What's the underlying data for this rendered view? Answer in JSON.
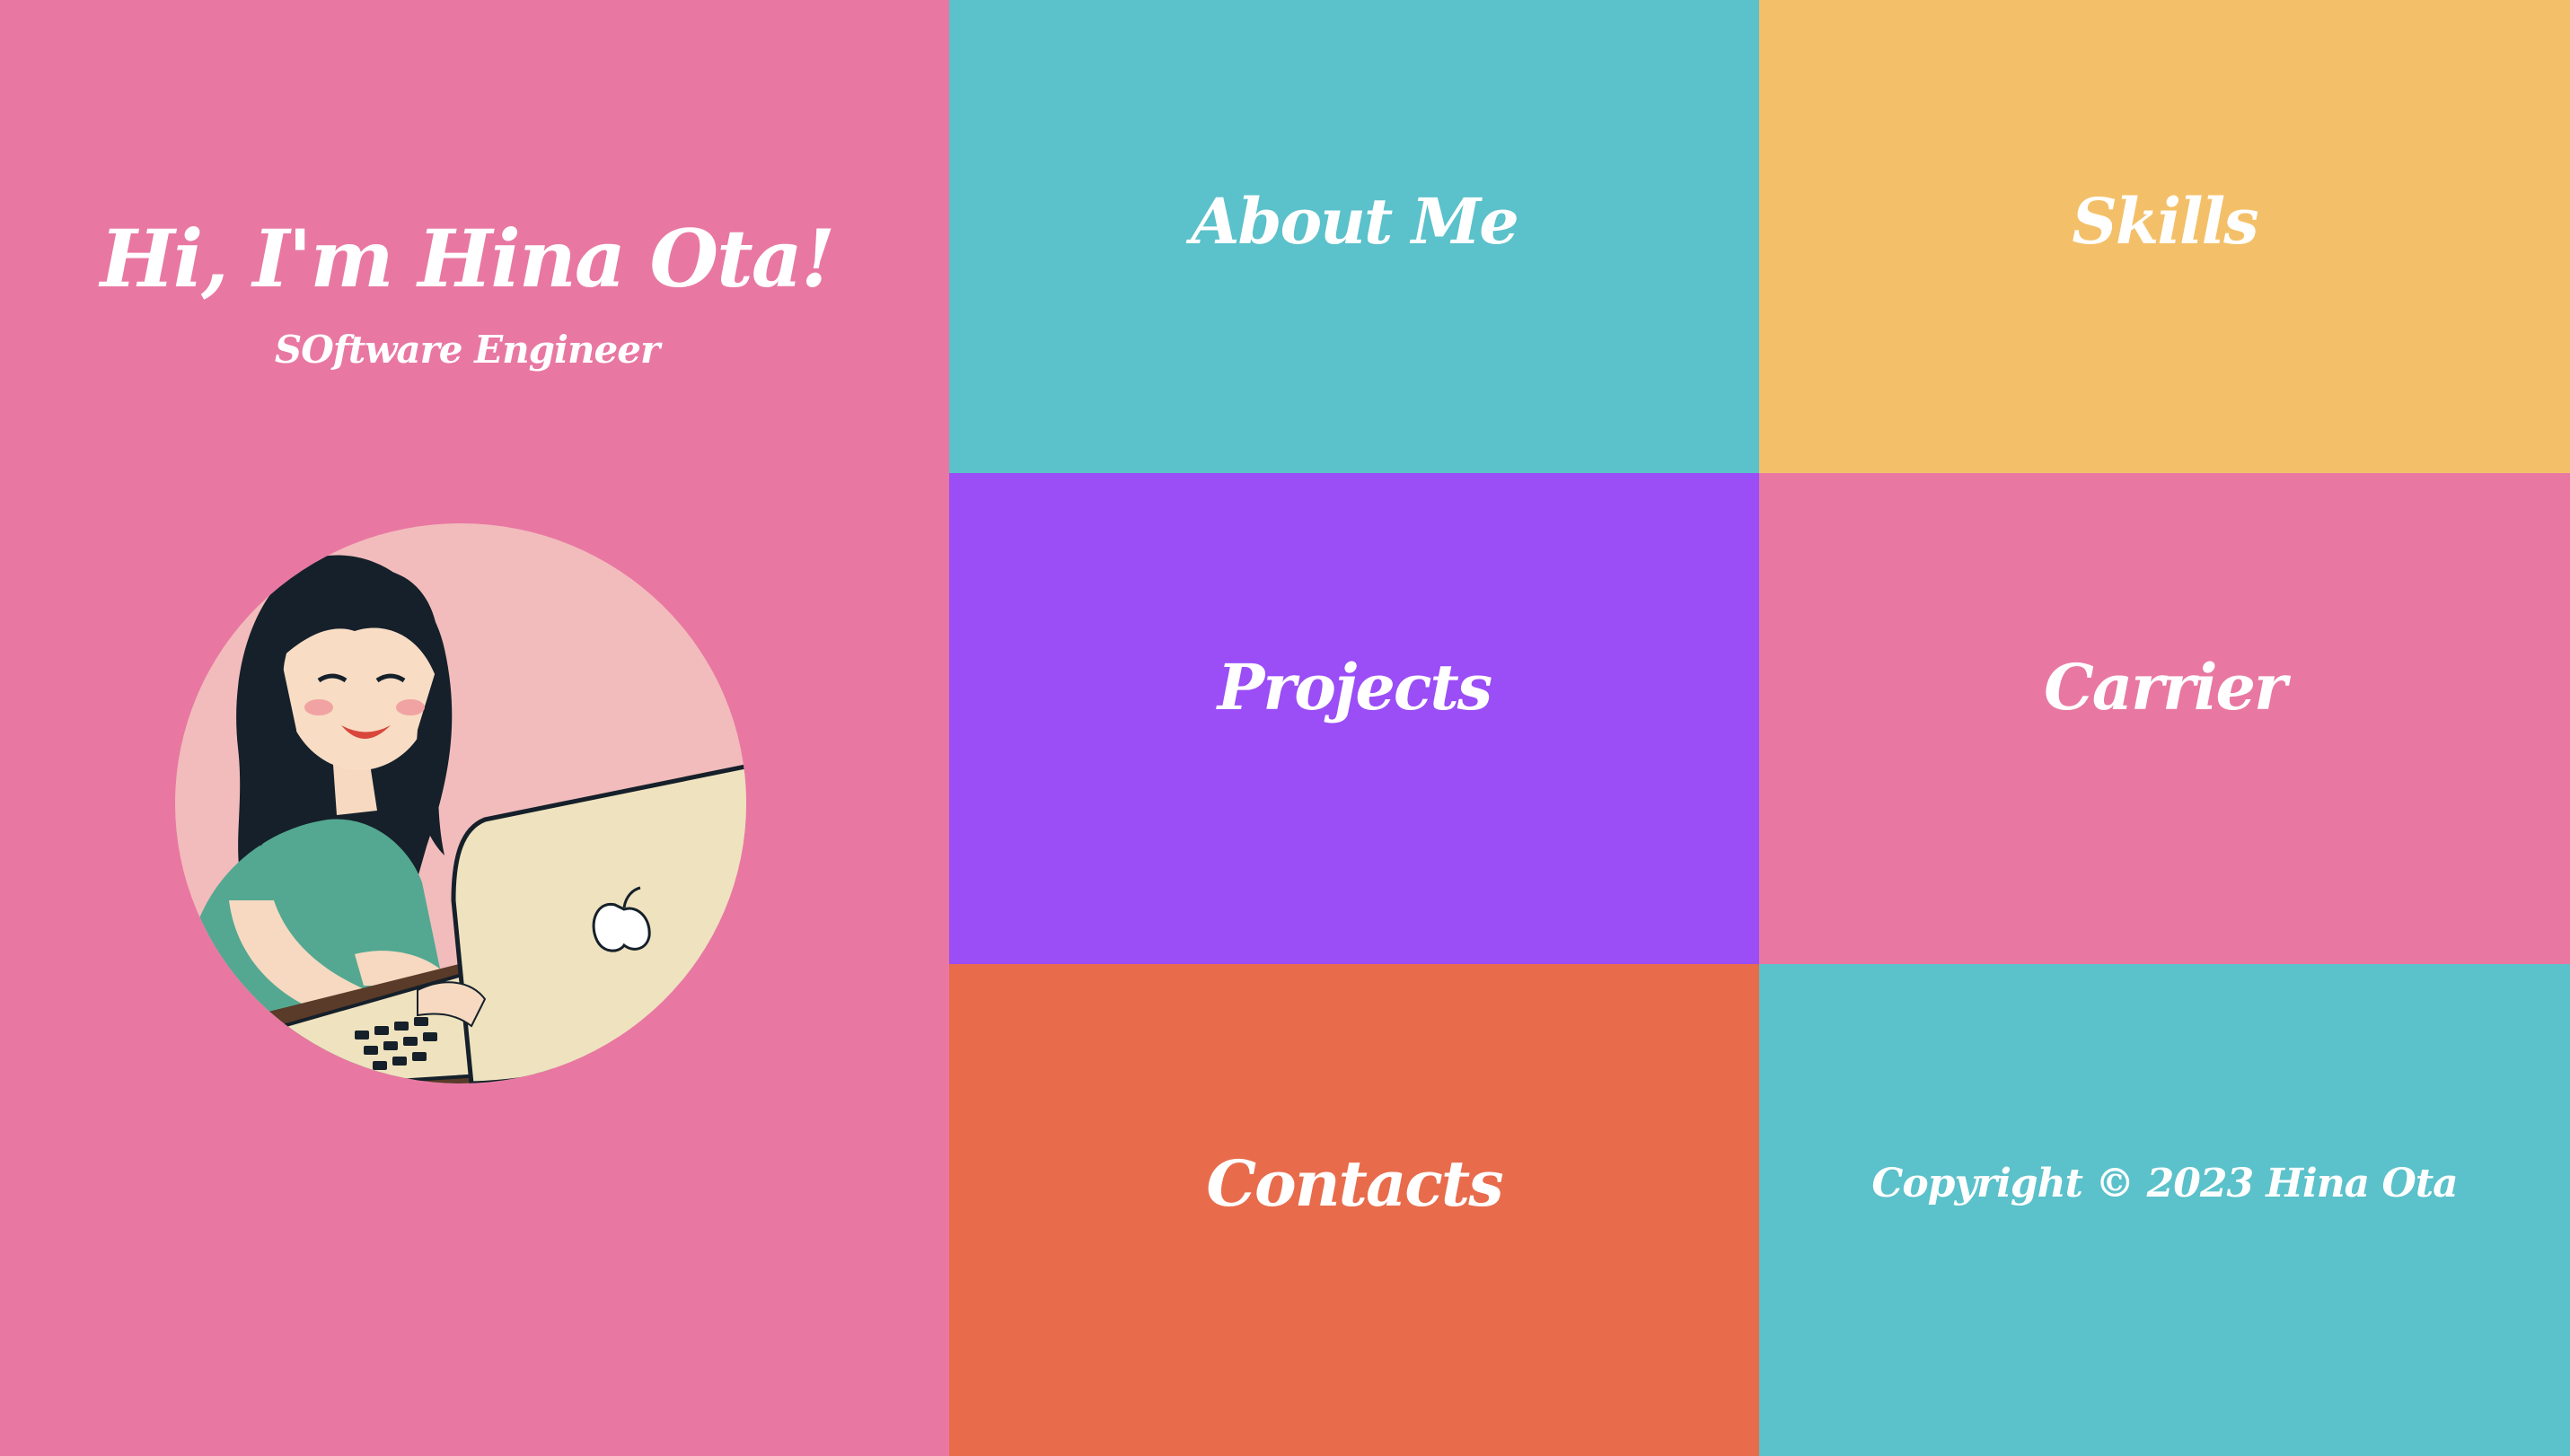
{
  "colors": {
    "pink": "#e878a2",
    "teal": "#5bc1ca",
    "yellow": "#f3c069",
    "purple": "#9b4df6",
    "orange": "#e86c4c",
    "text": "#ffffff"
  },
  "hero": {
    "title": "Hi, I'm Hina Ota!",
    "subtitle": "SOftware Engineer",
    "avatar": "illustration of smiling woman typing on laptop"
  },
  "nav": {
    "about": "About Me",
    "skills": "Skills",
    "projects": "Projects",
    "carrier": "Carrier",
    "contacts": "Contacts"
  },
  "footer": {
    "copyright": "Copyright © 2023 Hina Ota"
  }
}
